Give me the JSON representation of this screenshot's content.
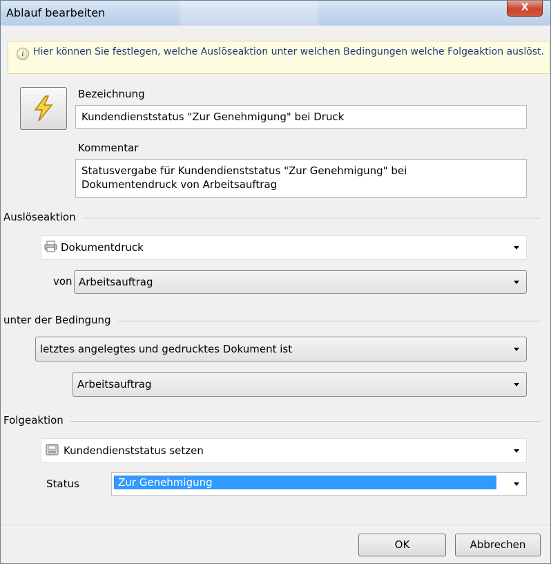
{
  "window": {
    "title": "Ablauf bearbeiten",
    "close_label": "X"
  },
  "info": {
    "text": "Hier können Sie festlegen, welche Auslöseaktion unter welchen Bedingungen welche Folgeaktion auslöst."
  },
  "icon": "lightning-icon",
  "bezeichnung": {
    "label": "Bezeichnung",
    "value": "Kundendienststatus \"Zur Genehmigung\" bei Druck"
  },
  "kommentar": {
    "label": "Kommentar",
    "line1": "Statusvergabe für Kundendienststatus \"Zur Genehmigung\" bei",
    "line2": "Dokumentendruck von Arbeitsauftrag"
  },
  "ausloeseaktion": {
    "section": "Auslöseaktion",
    "action": "Dokumentdruck",
    "action_icon": "printer-icon",
    "von_label": "von",
    "von_value": "Arbeitsauftrag"
  },
  "bedingung": {
    "section": "unter der Bedingung",
    "condition": "letztes angelegtes und gedrucktes Dokument ist",
    "document": "Arbeitsauftrag"
  },
  "folgeaktion": {
    "section": "Folgeaktion",
    "action": "Kundendienststatus setzen",
    "action_icon": "status-icon",
    "status_label": "Status",
    "status_value": "Zur Genehmigung"
  },
  "buttons": {
    "ok": "OK",
    "cancel": "Abbrechen"
  },
  "colors": {
    "selection": "#3399ff",
    "info_text": "#1a3a7a",
    "close_button": "#c9452b"
  }
}
